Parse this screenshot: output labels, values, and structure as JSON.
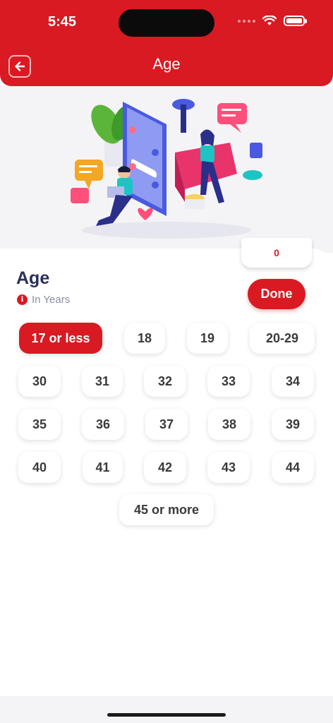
{
  "status_bar": {
    "time": "5:45"
  },
  "header": {
    "title": "Age"
  },
  "selection": {
    "count": "0"
  },
  "section": {
    "title": "Age",
    "subtitle": "In Years",
    "info_icon": "i"
  },
  "actions": {
    "done_label": "Done"
  },
  "age_options": [
    {
      "label": "17 or less",
      "selected": true
    },
    {
      "label": "18",
      "selected": false
    },
    {
      "label": "19",
      "selected": false
    },
    {
      "label": "20-29",
      "selected": false
    },
    {
      "label": "30",
      "selected": false
    },
    {
      "label": "31",
      "selected": false
    },
    {
      "label": "32",
      "selected": false
    },
    {
      "label": "33",
      "selected": false
    },
    {
      "label": "34",
      "selected": false
    },
    {
      "label": "35",
      "selected": false
    },
    {
      "label": "36",
      "selected": false
    },
    {
      "label": "37",
      "selected": false
    },
    {
      "label": "38",
      "selected": false
    },
    {
      "label": "39",
      "selected": false
    },
    {
      "label": "40",
      "selected": false
    },
    {
      "label": "41",
      "selected": false
    },
    {
      "label": "42",
      "selected": false
    },
    {
      "label": "43",
      "selected": false
    },
    {
      "label": "44",
      "selected": false
    },
    {
      "label": "45 or more",
      "selected": false
    }
  ],
  "colors": {
    "brand": "#d91a22",
    "title": "#2b2f5a",
    "muted": "#8a8fa3"
  },
  "icons": {
    "back": "arrow-left-icon",
    "wifi": "wifi-icon",
    "battery": "battery-icon",
    "info": "info-icon"
  }
}
